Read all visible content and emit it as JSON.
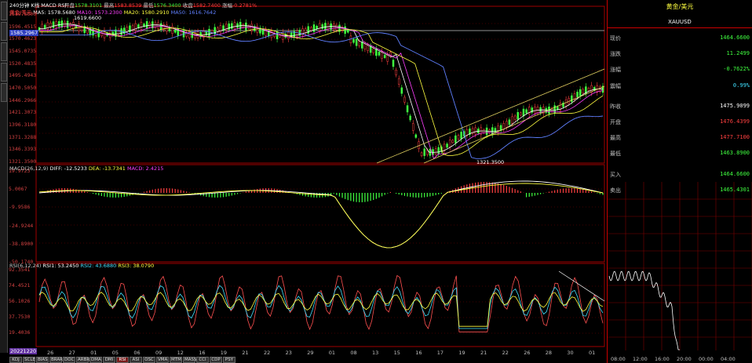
{
  "toolbar": {
    "period_label": "240分钟 K线 MACD RSI",
    "open_label": "开盘",
    "open_value": "1578.3101",
    "high_label": "最高",
    "high_value": "1583.8539",
    "low_label": "最低",
    "low_value": "1576.3400",
    "close_label": "收盘",
    "close_value": "1582.7400",
    "change_label": "涨幅",
    "change_value": "-0.2781%"
  },
  "ma_legend": {
    "name": "黄金/美元",
    "ma5": "MA5: 1578.5680",
    "ma10": "MA10: 1573.2300",
    "ma20": "MA20: 1580.2910",
    "ma50": "MA50: 1616.7642"
  },
  "price_axis": [
    "1619.6600",
    "1596.4515",
    "1570.4623",
    "1545.0735",
    "1520.4835",
    "1495.4943",
    "1470.5050",
    "1446.2966",
    "1421.3073",
    "1396.3180",
    "1371.3288",
    "1346.3393",
    "1321.3500"
  ],
  "price_cursor_value": "1585.2967",
  "peak_label": "1619.6600",
  "low_label": "1321.3500",
  "macd_legend": {
    "title": "MACD(26,12,9)",
    "diff": "DIFF: -12.5233",
    "dea": "DEA: -13.7341",
    "macd": "MACD: 2.4215"
  },
  "macd_axis": [
    "19.9723",
    "5.0067",
    "-9.9586",
    "-24.9244",
    "-38.8900",
    "-50.1740"
  ],
  "rsi_legend": {
    "title": "RSI(6,12,24)",
    "rsi1": "RSI1: 53.2450",
    "rsi2": "RSI2: 43.6880",
    "rsi3": "RSI3: 38.0790"
  },
  "rsi_axis": [
    "92.3541",
    "74.4521",
    "56.1026",
    "37.7530",
    "19.4036"
  ],
  "date_axis_box": "20221220",
  "x_labels": [
    "26",
    "27",
    "01",
    "05",
    "06",
    "09",
    "12",
    "16",
    "19",
    "21",
    "22",
    "23",
    "29",
    "01",
    "08",
    "13",
    "15",
    "16",
    "17",
    "19",
    "21",
    "22",
    "26",
    "28",
    "30",
    "01"
  ],
  "bottom_tabs": [
    "KDJ",
    "SCLE",
    "BIAS",
    "BRAR",
    "DOC",
    "ARBR",
    "DMA",
    "DMI",
    "RSI",
    "ASI",
    "OSC",
    "VMA",
    "MTM",
    "MASS",
    "CCI",
    "CDP",
    "PSY"
  ],
  "active_tab": "RSI",
  "quote": {
    "title": "黄金/美元",
    "symbol": "XAUUSD",
    "rows": [
      {
        "label": "现价",
        "value": "1464.6600",
        "color": "green"
      },
      {
        "label": "涨跌",
        "value": "11.2499",
        "color": "green"
      },
      {
        "label": "涨幅",
        "value": "-0.7622%",
        "color": "green"
      },
      {
        "label": "震幅",
        "value": "0.99%",
        "color": "cyan"
      },
      {
        "label": "昨收",
        "value": "1475.9099",
        "color": "white"
      },
      {
        "label": "开盘",
        "value": "1476.4399",
        "color": "red"
      },
      {
        "label": "最高",
        "value": "1477.7100",
        "color": "red"
      },
      {
        "label": "最低",
        "value": "1463.8900",
        "color": "green"
      },
      {
        "label": "买入",
        "value": "1464.6600",
        "color": "green"
      },
      {
        "label": "卖出",
        "value": "1465.4301",
        "color": "green"
      }
    ]
  },
  "mini_chart_times": [
    "08:00",
    "12:00",
    "16:00",
    "20:00",
    "00:00",
    "04:00"
  ]
}
